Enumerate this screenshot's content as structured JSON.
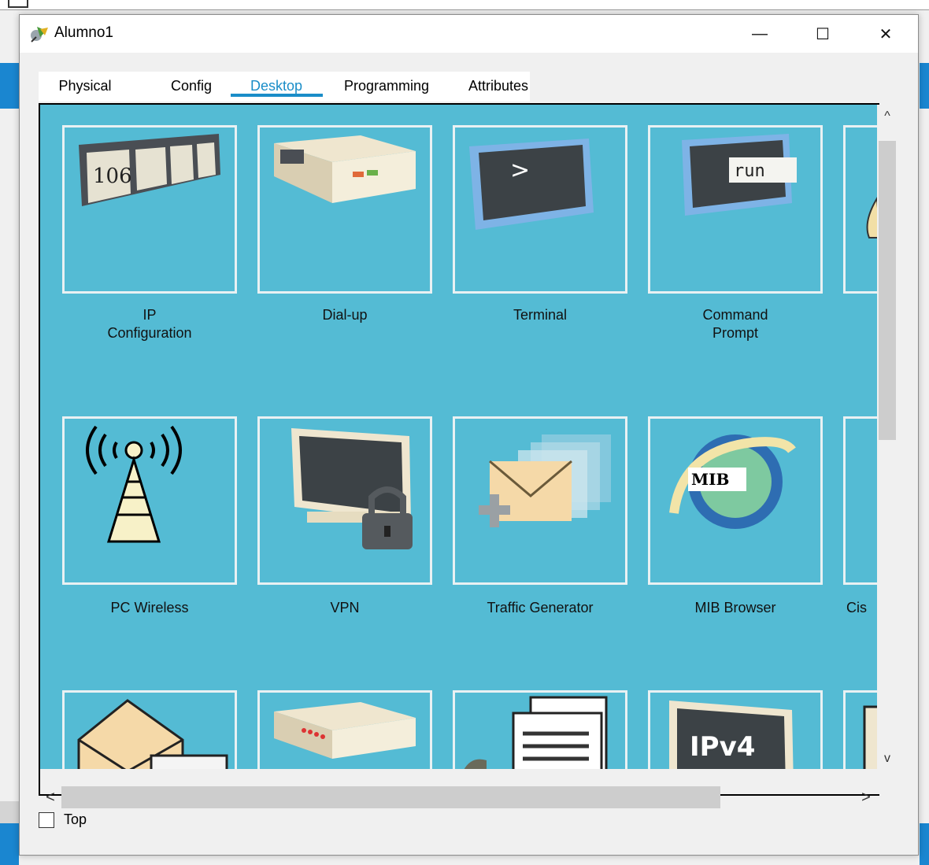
{
  "window": {
    "title": "Alumno1",
    "controls": {
      "minimize": "—",
      "maximize": "☐",
      "close": "✕"
    }
  },
  "tabs": [
    {
      "label": "Physical",
      "active": false
    },
    {
      "label": "Config",
      "active": false
    },
    {
      "label": "Desktop",
      "active": true
    },
    {
      "label": "Programming",
      "active": false
    },
    {
      "label": "Attributes",
      "active": false
    }
  ],
  "desktop_apps": {
    "row1": [
      {
        "name": "ip-configuration",
        "label_line1": "IP",
        "label_line2": "Configuration",
        "icon_text": "106"
      },
      {
        "name": "dial-up",
        "label_line1": "Dial-up",
        "label_line2": ""
      },
      {
        "name": "terminal",
        "label_line1": "Terminal",
        "label_line2": "",
        "icon_text": ">"
      },
      {
        "name": "command-prompt",
        "label_line1": "Command",
        "label_line2": "Prompt",
        "icon_text": "run"
      }
    ],
    "row2": [
      {
        "name": "pc-wireless",
        "label": "PC Wireless"
      },
      {
        "name": "vpn",
        "label": "VPN"
      },
      {
        "name": "traffic-generator",
        "label": "Traffic Generator"
      },
      {
        "name": "mib-browser",
        "label": "MIB Browser",
        "icon_text": "MIB"
      },
      {
        "name": "cisco-partial",
        "label": "Cis"
      }
    ],
    "row3": [
      {
        "name": "email"
      },
      {
        "name": "pppoe-dialer"
      },
      {
        "name": "text-editor"
      },
      {
        "name": "ipv6-firewall",
        "icon_text": "IPv4"
      }
    ]
  },
  "scroll": {
    "up": "^",
    "down": "v",
    "left": "<",
    "right": ">"
  },
  "footer": {
    "top_checkbox_label": "Top",
    "top_checked": false
  },
  "colors": {
    "desktop_bg": "#54bbd4",
    "accent": "#1a8dc8",
    "tile_border": "#e9f1f3"
  }
}
